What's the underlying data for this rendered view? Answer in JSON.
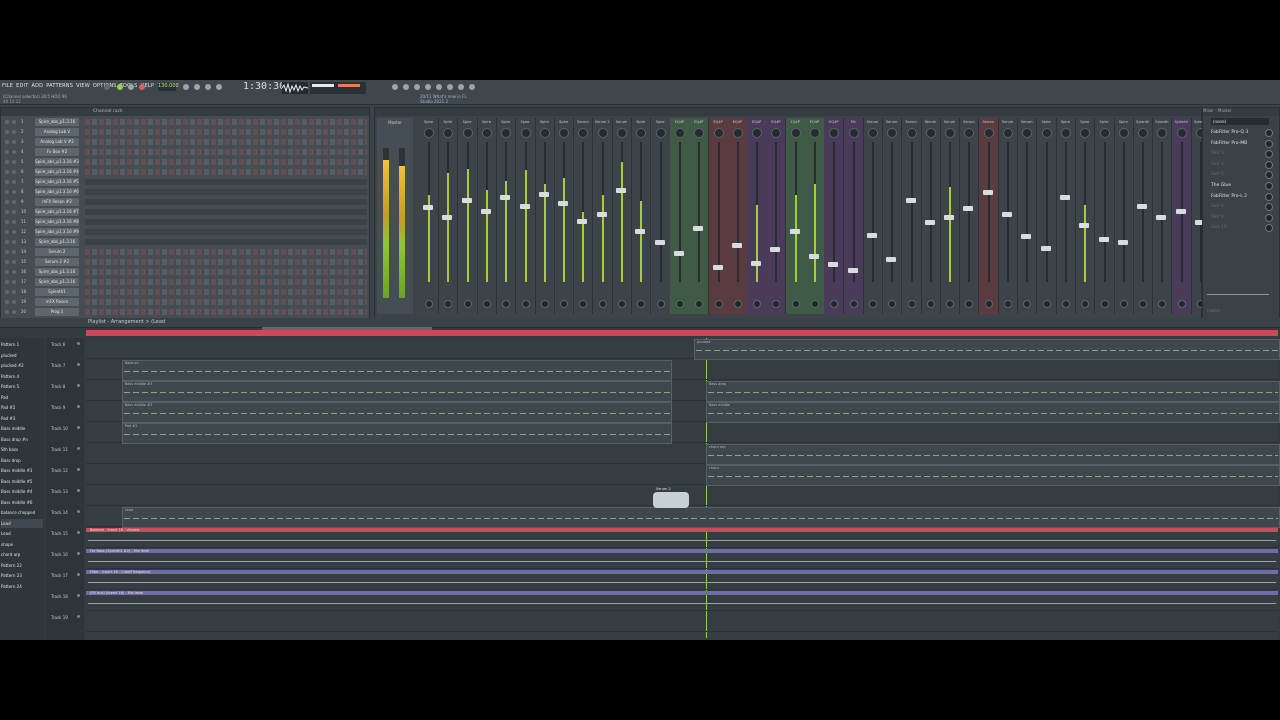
{
  "menu": [
    "FILE",
    "EDIT",
    "ADD",
    "PATTERNS",
    "VIEW",
    "OPTIONS",
    "TOOLS",
    "HELP"
  ],
  "hint_line1": "(Channel selector) 30.5 HOO 96",
  "hint_line2": "49 10 22",
  "tempo": "130.000",
  "time_display": "1:30:30",
  "news_line1": "20/11 What's new in FL",
  "news_line2": "Studio 2021.2",
  "channel_rack": {
    "title": "Channel rack",
    "rows": [
      {
        "num": "1",
        "name": "Spire_abs_p1.3.16"
      },
      {
        "num": "2",
        "name": "Analog Lab V"
      },
      {
        "num": "3",
        "name": "Analog Lab V #2"
      },
      {
        "num": "4",
        "name": "Fx Box #2"
      },
      {
        "num": "5",
        "name": "Spire_abs_p1.3.16 #3"
      },
      {
        "num": "6",
        "name": "Spire_abs_p1.3.16 #4"
      },
      {
        "num": "7",
        "name": "Spire_abs_p1.3.16 #5"
      },
      {
        "num": "8",
        "name": "Spire_abs_p1.3.16 #6"
      },
      {
        "num": "9",
        "name": "mFX Reson #2"
      },
      {
        "num": "10",
        "name": "Spire_abs_p1.3.16 #7"
      },
      {
        "num": "11",
        "name": "Spire_abs_p1.3.16 #8"
      },
      {
        "num": "12",
        "name": "Spire_abs_p1.3.16 #9"
      },
      {
        "num": "13",
        "name": "Spire_abs_p1.3.16 #10"
      },
      {
        "num": "14",
        "name": "Serum 2"
      },
      {
        "num": "15",
        "name": "Serum 2 #2"
      },
      {
        "num": "16",
        "name": "Spire_abs_p1.3.16 #11"
      },
      {
        "num": "17",
        "name": "Spire_abs_p1.3.16 #12"
      },
      {
        "num": "18",
        "name": "Sylenth1"
      },
      {
        "num": "19",
        "name": "mFX Reson"
      },
      {
        "num": "20",
        "name": "Prog 1"
      }
    ]
  },
  "mixer": {
    "title": "Mixer",
    "master_label": "Master",
    "strips": [
      {
        "label": "Spire",
        "level": 0.62,
        "fader": 0.45,
        "tint": ""
      },
      {
        "label": "Spire",
        "level": 0.78,
        "fader": 0.52,
        "tint": ""
      },
      {
        "label": "Spire",
        "level": 0.81,
        "fader": 0.4,
        "tint": ""
      },
      {
        "label": "Spire",
        "level": 0.66,
        "fader": 0.48,
        "tint": ""
      },
      {
        "label": "Spire",
        "level": 0.72,
        "fader": 0.38,
        "tint": ""
      },
      {
        "label": "Spire",
        "level": 0.8,
        "fader": 0.44,
        "tint": ""
      },
      {
        "label": "Spire",
        "level": 0.7,
        "fader": 0.36,
        "tint": ""
      },
      {
        "label": "Spire",
        "level": 0.74,
        "fader": 0.42,
        "tint": ""
      },
      {
        "label": "Serum",
        "level": 0.5,
        "fader": 0.55,
        "tint": ""
      },
      {
        "label": "Serum 2",
        "level": 0.62,
        "fader": 0.5,
        "tint": ""
      },
      {
        "label": "Serum",
        "level": 0.86,
        "fader": 0.33,
        "tint": ""
      },
      {
        "label": "Spire",
        "level": 0.58,
        "fader": 0.62,
        "tint": ""
      },
      {
        "label": "Spire",
        "level": 0.0,
        "fader": 0.7,
        "tint": ""
      },
      {
        "label": "EQ4P",
        "level": 0.0,
        "fader": 0.78,
        "tint": "#3f5a45"
      },
      {
        "label": "EQ4P",
        "level": 0.0,
        "fader": 0.6,
        "tint": "#3f5a45"
      },
      {
        "label": "EQ4P",
        "level": 0.0,
        "fader": 0.88,
        "tint": "#5a3b3f"
      },
      {
        "label": "EQ4P",
        "level": 0.0,
        "fader": 0.72,
        "tint": "#5a3b3f"
      },
      {
        "label": "EQ4P",
        "level": 0.55,
        "fader": 0.85,
        "tint": "#4a3b5a"
      },
      {
        "label": "EQ4P",
        "level": 0.0,
        "fader": 0.75,
        "tint": "#4a3b5a"
      },
      {
        "label": "EQ4P",
        "level": 0.62,
        "fader": 0.62,
        "tint": "#3f5a45"
      },
      {
        "label": "EQ4P",
        "level": 0.7,
        "fader": 0.8,
        "tint": "#3f5a45"
      },
      {
        "label": "EQ4P",
        "level": 0.0,
        "fader": 0.86,
        "tint": "#4a3b5a"
      },
      {
        "label": "Fill",
        "level": 0.0,
        "fader": 0.9,
        "tint": "#4a3b5a"
      },
      {
        "label": "Serum",
        "level": 0.0,
        "fader": 0.65,
        "tint": ""
      },
      {
        "label": "Serum",
        "level": 0.0,
        "fader": 0.82,
        "tint": ""
      },
      {
        "label": "Serum",
        "level": 0.0,
        "fader": 0.4,
        "tint": ""
      },
      {
        "label": "Serum",
        "level": 0.0,
        "fader": 0.56,
        "tint": ""
      },
      {
        "label": "Serum",
        "level": 0.68,
        "fader": 0.52,
        "tint": ""
      },
      {
        "label": "Serum",
        "level": 0.0,
        "fader": 0.46,
        "tint": ""
      },
      {
        "label": "Serum",
        "level": 0.0,
        "fader": 0.34,
        "tint": "#5a3b3f"
      },
      {
        "label": "Serum",
        "level": 0.0,
        "fader": 0.5,
        "tint": ""
      },
      {
        "label": "Serum",
        "level": 0.0,
        "fader": 0.66,
        "tint": ""
      },
      {
        "label": "Spire",
        "level": 0.0,
        "fader": 0.74,
        "tint": ""
      },
      {
        "label": "Spire",
        "level": 0.0,
        "fader": 0.38,
        "tint": ""
      },
      {
        "label": "Spire",
        "level": 0.55,
        "fader": 0.58,
        "tint": ""
      },
      {
        "label": "Spire",
        "level": 0.0,
        "fader": 0.68,
        "tint": ""
      },
      {
        "label": "Spire",
        "level": 0.0,
        "fader": 0.7,
        "tint": ""
      },
      {
        "label": "Sylenth",
        "level": 0.0,
        "fader": 0.44,
        "tint": ""
      },
      {
        "label": "Sylenth",
        "level": 0.0,
        "fader": 0.52,
        "tint": ""
      },
      {
        "label": "Sylenth",
        "level": 0.0,
        "fader": 0.48,
        "tint": "#4a3b5a"
      },
      {
        "label": "Sylenth",
        "level": 0.0,
        "fader": 0.56,
        "tint": ""
      }
    ]
  },
  "fx_panel": {
    "header": "Mixer - Master",
    "selector": "(none)",
    "slots": [
      {
        "name": "FabFilter Pro-Q 3",
        "on": true
      },
      {
        "name": "FabFilter Pro-MB",
        "on": true
      },
      {
        "name": "Slot 3",
        "on": false
      },
      {
        "name": "Slot 4",
        "on": false
      },
      {
        "name": "Slot 5",
        "on": false
      },
      {
        "name": "The Glue",
        "on": true
      },
      {
        "name": "FabFilter Pro-L 2",
        "on": true
      },
      {
        "name": "Slot 8",
        "on": false
      },
      {
        "name": "Slot 9",
        "on": false
      },
      {
        "name": "Slot 10",
        "on": false
      }
    ],
    "footer": "(none)"
  },
  "playlist": {
    "title": "Playlist - Arrangement > (Lead",
    "patterns": [
      "Pattern 1",
      "plucked",
      "plucked #2",
      "Pattern 4",
      "Pattern 5",
      "Pad",
      "Pad #2",
      "Pad #3",
      "Bass middle",
      "Bass drop #n",
      "Sth bass",
      "Bass drop",
      "Bass middle #3",
      "Bass middle #5",
      "Bass middle #4",
      "Bass middle #6",
      "balance chopped",
      "Lead",
      "Lead",
      "shape",
      "chord arp",
      "Pattern 22",
      "Pattern 23",
      "Pattern 24"
    ],
    "selected_pattern": 17,
    "tracks": [
      "Track 6",
      "Track 7",
      "Track 8",
      "Track 9",
      "Track 10",
      "Track 11",
      "Track 12",
      "Track 13",
      "Track 14",
      "Track 15",
      "Track 16",
      "Track 17",
      "Track 18",
      "Track 19"
    ],
    "clips": [
      {
        "track": 0,
        "label": "plucked",
        "start": 0.51,
        "end": 1.0
      },
      {
        "track": 1,
        "label": "Balance",
        "start": 0.03,
        "end": 0.49
      },
      {
        "track": 2,
        "label": "Bass middle #3",
        "start": 0.03,
        "end": 0.49
      },
      {
        "track": 2,
        "label": "Bass drop",
        "start": 0.52,
        "end": 1.0
      },
      {
        "track": 3,
        "label": "Bass middle #3",
        "start": 0.03,
        "end": 0.49
      },
      {
        "track": 3,
        "label": "Bass middle",
        "start": 0.52,
        "end": 1.0
      },
      {
        "track": 4,
        "label": "Pad #2",
        "start": 0.03,
        "end": 0.49
      },
      {
        "track": 5,
        "label": "chord arp",
        "start": 0.52,
        "end": 1.0
      },
      {
        "track": 6,
        "label": "chord",
        "start": 0.52,
        "end": 1.0
      },
      {
        "track": 8,
        "label": "Lead",
        "start": 0.03,
        "end": 1.0
      }
    ],
    "automation": [
      {
        "track": 9,
        "label": "Balance - Insert 16 - Volume",
        "color": "#c94b56",
        "start": 0.0,
        "end": 1.0
      },
      {
        "track": 10,
        "label": "Fer Bass (Sylenth1 #2) - Mix level",
        "color": "#6c6ea8",
        "start": 0.0,
        "end": 1.0
      },
      {
        "track": 11,
        "label": "Filter - Insert 16 - Cutoff frequency",
        "color": "#6c6ea8",
        "start": 0.0,
        "end": 1.0
      },
      {
        "track": 12,
        "label": "(Fill bus) (Insert 16) - Mix level",
        "color": "#6c6ea8",
        "start": 0.0,
        "end": 1.0
      }
    ],
    "playhead_fraction": 0.52,
    "cursor_label": "Serum 2"
  }
}
